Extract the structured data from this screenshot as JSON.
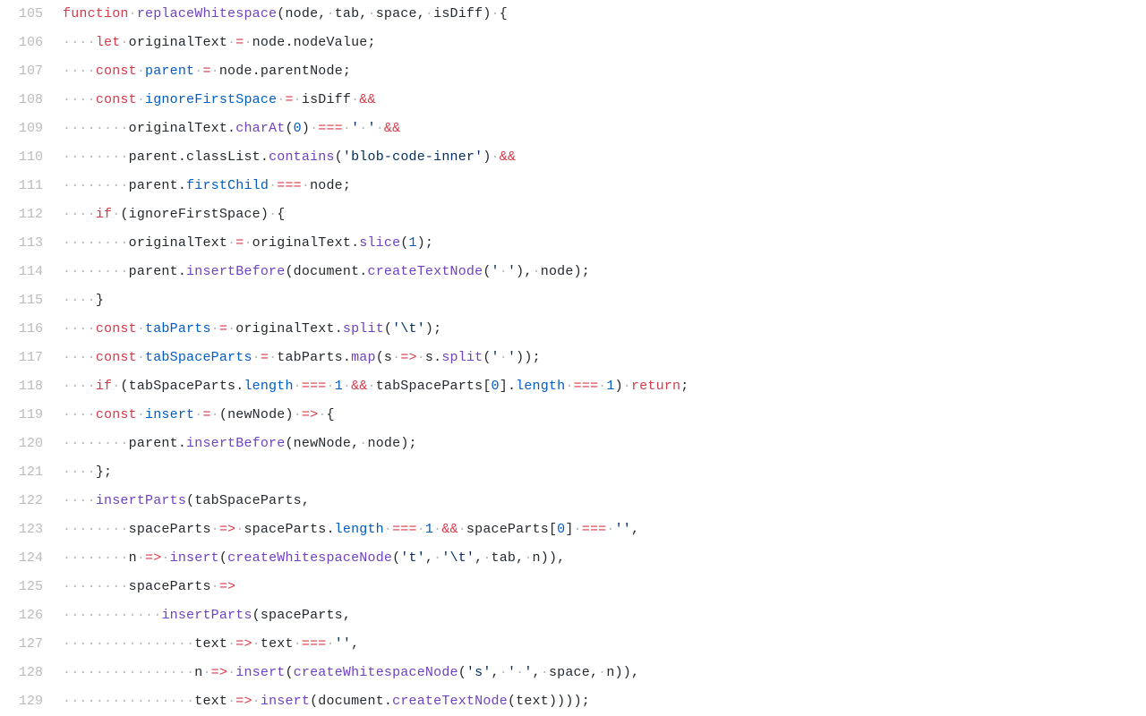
{
  "startLine": 105,
  "lines": [
    {
      "indent": 0,
      "tokens": [
        {
          "t": "kw",
          "v": "function"
        },
        {
          "t": "sp"
        },
        {
          "t": "fn",
          "v": "replaceWhitespace"
        },
        {
          "t": "pun",
          "v": "("
        },
        {
          "t": "var",
          "v": "node"
        },
        {
          "t": "pun",
          "v": ","
        },
        {
          "t": "sp"
        },
        {
          "t": "var",
          "v": "tab"
        },
        {
          "t": "pun",
          "v": ","
        },
        {
          "t": "sp"
        },
        {
          "t": "var",
          "v": "space"
        },
        {
          "t": "pun",
          "v": ","
        },
        {
          "t": "sp"
        },
        {
          "t": "var",
          "v": "isDiff"
        },
        {
          "t": "pun",
          "v": ")"
        },
        {
          "t": "sp"
        },
        {
          "t": "pun",
          "v": "{"
        }
      ]
    },
    {
      "indent": 4,
      "tokens": [
        {
          "t": "kw",
          "v": "let"
        },
        {
          "t": "sp"
        },
        {
          "t": "var",
          "v": "originalText"
        },
        {
          "t": "sp"
        },
        {
          "t": "op",
          "v": "="
        },
        {
          "t": "sp"
        },
        {
          "t": "var",
          "v": "node"
        },
        {
          "t": "pun",
          "v": "."
        },
        {
          "t": "var",
          "v": "nodeValue"
        },
        {
          "t": "pun",
          "v": ";"
        }
      ]
    },
    {
      "indent": 4,
      "tokens": [
        {
          "t": "kw",
          "v": "const"
        },
        {
          "t": "sp"
        },
        {
          "t": "decl",
          "v": "parent"
        },
        {
          "t": "sp"
        },
        {
          "t": "op",
          "v": "="
        },
        {
          "t": "sp"
        },
        {
          "t": "var",
          "v": "node"
        },
        {
          "t": "pun",
          "v": "."
        },
        {
          "t": "var",
          "v": "parentNode"
        },
        {
          "t": "pun",
          "v": ";"
        }
      ]
    },
    {
      "indent": 4,
      "tokens": [
        {
          "t": "kw",
          "v": "const"
        },
        {
          "t": "sp"
        },
        {
          "t": "decl",
          "v": "ignoreFirstSpace"
        },
        {
          "t": "sp"
        },
        {
          "t": "op",
          "v": "="
        },
        {
          "t": "sp"
        },
        {
          "t": "var",
          "v": "isDiff"
        },
        {
          "t": "sp"
        },
        {
          "t": "op",
          "v": "&&"
        }
      ]
    },
    {
      "indent": 8,
      "tokens": [
        {
          "t": "var",
          "v": "originalText"
        },
        {
          "t": "pun",
          "v": "."
        },
        {
          "t": "fn",
          "v": "charAt"
        },
        {
          "t": "pun",
          "v": "("
        },
        {
          "t": "num",
          "v": "0"
        },
        {
          "t": "pun",
          "v": ")"
        },
        {
          "t": "sp"
        },
        {
          "t": "op",
          "v": "==="
        },
        {
          "t": "sp"
        },
        {
          "t": "str",
          "v": "' '"
        },
        {
          "t": "sp"
        },
        {
          "t": "op",
          "v": "&&"
        }
      ]
    },
    {
      "indent": 8,
      "tokens": [
        {
          "t": "var",
          "v": "parent"
        },
        {
          "t": "pun",
          "v": "."
        },
        {
          "t": "var",
          "v": "classList"
        },
        {
          "t": "pun",
          "v": "."
        },
        {
          "t": "fn",
          "v": "contains"
        },
        {
          "t": "pun",
          "v": "("
        },
        {
          "t": "str",
          "v": "'blob-code-inner'"
        },
        {
          "t": "pun",
          "v": ")"
        },
        {
          "t": "sp"
        },
        {
          "t": "op",
          "v": "&&"
        }
      ]
    },
    {
      "indent": 8,
      "tokens": [
        {
          "t": "var",
          "v": "parent"
        },
        {
          "t": "pun",
          "v": "."
        },
        {
          "t": "decl",
          "v": "firstChild"
        },
        {
          "t": "sp"
        },
        {
          "t": "op",
          "v": "==="
        },
        {
          "t": "sp"
        },
        {
          "t": "var",
          "v": "node"
        },
        {
          "t": "pun",
          "v": ";"
        }
      ]
    },
    {
      "indent": 4,
      "tokens": [
        {
          "t": "kw",
          "v": "if"
        },
        {
          "t": "sp"
        },
        {
          "t": "pun",
          "v": "("
        },
        {
          "t": "var",
          "v": "ignoreFirstSpace"
        },
        {
          "t": "pun",
          "v": ")"
        },
        {
          "t": "sp"
        },
        {
          "t": "pun",
          "v": "{"
        }
      ]
    },
    {
      "indent": 8,
      "tokens": [
        {
          "t": "var",
          "v": "originalText"
        },
        {
          "t": "sp"
        },
        {
          "t": "op",
          "v": "="
        },
        {
          "t": "sp"
        },
        {
          "t": "var",
          "v": "originalText"
        },
        {
          "t": "pun",
          "v": "."
        },
        {
          "t": "fn",
          "v": "slice"
        },
        {
          "t": "pun",
          "v": "("
        },
        {
          "t": "num",
          "v": "1"
        },
        {
          "t": "pun",
          "v": ")"
        },
        {
          "t": "pun",
          "v": ";"
        }
      ]
    },
    {
      "indent": 8,
      "tokens": [
        {
          "t": "var",
          "v": "parent"
        },
        {
          "t": "pun",
          "v": "."
        },
        {
          "t": "fn",
          "v": "insertBefore"
        },
        {
          "t": "pun",
          "v": "("
        },
        {
          "t": "var",
          "v": "document"
        },
        {
          "t": "pun",
          "v": "."
        },
        {
          "t": "fn",
          "v": "createTextNode"
        },
        {
          "t": "pun",
          "v": "("
        },
        {
          "t": "str",
          "v": "' '"
        },
        {
          "t": "pun",
          "v": ")"
        },
        {
          "t": "pun",
          "v": ","
        },
        {
          "t": "sp"
        },
        {
          "t": "var",
          "v": "node"
        },
        {
          "t": "pun",
          "v": ")"
        },
        {
          "t": "pun",
          "v": ";"
        }
      ]
    },
    {
      "indent": 4,
      "tokens": [
        {
          "t": "pun",
          "v": "}"
        }
      ]
    },
    {
      "indent": 4,
      "tokens": [
        {
          "t": "kw",
          "v": "const"
        },
        {
          "t": "sp"
        },
        {
          "t": "decl",
          "v": "tabParts"
        },
        {
          "t": "sp"
        },
        {
          "t": "op",
          "v": "="
        },
        {
          "t": "sp"
        },
        {
          "t": "var",
          "v": "originalText"
        },
        {
          "t": "pun",
          "v": "."
        },
        {
          "t": "fn",
          "v": "split"
        },
        {
          "t": "pun",
          "v": "("
        },
        {
          "t": "str",
          "v": "'\\t'"
        },
        {
          "t": "pun",
          "v": ")"
        },
        {
          "t": "pun",
          "v": ";"
        }
      ]
    },
    {
      "indent": 4,
      "tokens": [
        {
          "t": "kw",
          "v": "const"
        },
        {
          "t": "sp"
        },
        {
          "t": "decl",
          "v": "tabSpaceParts"
        },
        {
          "t": "sp"
        },
        {
          "t": "op",
          "v": "="
        },
        {
          "t": "sp"
        },
        {
          "t": "var",
          "v": "tabParts"
        },
        {
          "t": "pun",
          "v": "."
        },
        {
          "t": "fn",
          "v": "map"
        },
        {
          "t": "pun",
          "v": "("
        },
        {
          "t": "var",
          "v": "s"
        },
        {
          "t": "sp"
        },
        {
          "t": "op",
          "v": "=>"
        },
        {
          "t": "sp"
        },
        {
          "t": "var",
          "v": "s"
        },
        {
          "t": "pun",
          "v": "."
        },
        {
          "t": "fn",
          "v": "split"
        },
        {
          "t": "pun",
          "v": "("
        },
        {
          "t": "str",
          "v": "' '"
        },
        {
          "t": "pun",
          "v": ")"
        },
        {
          "t": "pun",
          "v": ")"
        },
        {
          "t": "pun",
          "v": ";"
        }
      ]
    },
    {
      "indent": 4,
      "tokens": [
        {
          "t": "kw",
          "v": "if"
        },
        {
          "t": "sp"
        },
        {
          "t": "pun",
          "v": "("
        },
        {
          "t": "var",
          "v": "tabSpaceParts"
        },
        {
          "t": "pun",
          "v": "."
        },
        {
          "t": "decl",
          "v": "length"
        },
        {
          "t": "sp"
        },
        {
          "t": "op",
          "v": "==="
        },
        {
          "t": "sp"
        },
        {
          "t": "num",
          "v": "1"
        },
        {
          "t": "sp"
        },
        {
          "t": "op",
          "v": "&&"
        },
        {
          "t": "sp"
        },
        {
          "t": "var",
          "v": "tabSpaceParts"
        },
        {
          "t": "pun",
          "v": "["
        },
        {
          "t": "num",
          "v": "0"
        },
        {
          "t": "pun",
          "v": "]"
        },
        {
          "t": "pun",
          "v": "."
        },
        {
          "t": "decl",
          "v": "length"
        },
        {
          "t": "sp"
        },
        {
          "t": "op",
          "v": "==="
        },
        {
          "t": "sp"
        },
        {
          "t": "num",
          "v": "1"
        },
        {
          "t": "pun",
          "v": ")"
        },
        {
          "t": "sp"
        },
        {
          "t": "kw",
          "v": "return"
        },
        {
          "t": "pun",
          "v": ";"
        }
      ]
    },
    {
      "indent": 4,
      "tokens": [
        {
          "t": "kw",
          "v": "const"
        },
        {
          "t": "sp"
        },
        {
          "t": "decl",
          "v": "insert"
        },
        {
          "t": "sp"
        },
        {
          "t": "op",
          "v": "="
        },
        {
          "t": "sp"
        },
        {
          "t": "pun",
          "v": "("
        },
        {
          "t": "var",
          "v": "newNode"
        },
        {
          "t": "pun",
          "v": ")"
        },
        {
          "t": "sp"
        },
        {
          "t": "op",
          "v": "=>"
        },
        {
          "t": "sp"
        },
        {
          "t": "pun",
          "v": "{"
        }
      ]
    },
    {
      "indent": 8,
      "tokens": [
        {
          "t": "var",
          "v": "parent"
        },
        {
          "t": "pun",
          "v": "."
        },
        {
          "t": "fn",
          "v": "insertBefore"
        },
        {
          "t": "pun",
          "v": "("
        },
        {
          "t": "var",
          "v": "newNode"
        },
        {
          "t": "pun",
          "v": ","
        },
        {
          "t": "sp"
        },
        {
          "t": "var",
          "v": "node"
        },
        {
          "t": "pun",
          "v": ")"
        },
        {
          "t": "pun",
          "v": ";"
        }
      ]
    },
    {
      "indent": 4,
      "tokens": [
        {
          "t": "pun",
          "v": "}"
        },
        {
          "t": "pun",
          "v": ";"
        }
      ]
    },
    {
      "indent": 4,
      "tokens": [
        {
          "t": "fn",
          "v": "insertParts"
        },
        {
          "t": "pun",
          "v": "("
        },
        {
          "t": "var",
          "v": "tabSpaceParts"
        },
        {
          "t": "pun",
          "v": ","
        }
      ]
    },
    {
      "indent": 8,
      "tokens": [
        {
          "t": "var",
          "v": "spaceParts"
        },
        {
          "t": "sp"
        },
        {
          "t": "op",
          "v": "=>"
        },
        {
          "t": "sp"
        },
        {
          "t": "var",
          "v": "spaceParts"
        },
        {
          "t": "pun",
          "v": "."
        },
        {
          "t": "decl",
          "v": "length"
        },
        {
          "t": "sp"
        },
        {
          "t": "op",
          "v": "==="
        },
        {
          "t": "sp"
        },
        {
          "t": "num",
          "v": "1"
        },
        {
          "t": "sp"
        },
        {
          "t": "op",
          "v": "&&"
        },
        {
          "t": "sp"
        },
        {
          "t": "var",
          "v": "spaceParts"
        },
        {
          "t": "pun",
          "v": "["
        },
        {
          "t": "num",
          "v": "0"
        },
        {
          "t": "pun",
          "v": "]"
        },
        {
          "t": "sp"
        },
        {
          "t": "op",
          "v": "==="
        },
        {
          "t": "sp"
        },
        {
          "t": "str",
          "v": "''"
        },
        {
          "t": "pun",
          "v": ","
        }
      ]
    },
    {
      "indent": 8,
      "tokens": [
        {
          "t": "var",
          "v": "n"
        },
        {
          "t": "sp"
        },
        {
          "t": "op",
          "v": "=>"
        },
        {
          "t": "sp"
        },
        {
          "t": "fn",
          "v": "insert"
        },
        {
          "t": "pun",
          "v": "("
        },
        {
          "t": "fn",
          "v": "createWhitespaceNode"
        },
        {
          "t": "pun",
          "v": "("
        },
        {
          "t": "str",
          "v": "'t'"
        },
        {
          "t": "pun",
          "v": ","
        },
        {
          "t": "sp"
        },
        {
          "t": "str",
          "v": "'\\t'"
        },
        {
          "t": "pun",
          "v": ","
        },
        {
          "t": "sp"
        },
        {
          "t": "var",
          "v": "tab"
        },
        {
          "t": "pun",
          "v": ","
        },
        {
          "t": "sp"
        },
        {
          "t": "var",
          "v": "n"
        },
        {
          "t": "pun",
          "v": ")"
        },
        {
          "t": "pun",
          "v": ")"
        },
        {
          "t": "pun",
          "v": ","
        }
      ]
    },
    {
      "indent": 8,
      "tokens": [
        {
          "t": "var",
          "v": "spaceParts"
        },
        {
          "t": "sp"
        },
        {
          "t": "op",
          "v": "=>"
        }
      ]
    },
    {
      "indent": 12,
      "tokens": [
        {
          "t": "fn",
          "v": "insertParts"
        },
        {
          "t": "pun",
          "v": "("
        },
        {
          "t": "var",
          "v": "spaceParts"
        },
        {
          "t": "pun",
          "v": ","
        }
      ]
    },
    {
      "indent": 16,
      "tokens": [
        {
          "t": "var",
          "v": "text"
        },
        {
          "t": "sp"
        },
        {
          "t": "op",
          "v": "=>"
        },
        {
          "t": "sp"
        },
        {
          "t": "var",
          "v": "text"
        },
        {
          "t": "sp"
        },
        {
          "t": "op",
          "v": "==="
        },
        {
          "t": "sp"
        },
        {
          "t": "str",
          "v": "''"
        },
        {
          "t": "pun",
          "v": ","
        }
      ]
    },
    {
      "indent": 16,
      "tokens": [
        {
          "t": "var",
          "v": "n"
        },
        {
          "t": "sp"
        },
        {
          "t": "op",
          "v": "=>"
        },
        {
          "t": "sp"
        },
        {
          "t": "fn",
          "v": "insert"
        },
        {
          "t": "pun",
          "v": "("
        },
        {
          "t": "fn",
          "v": "createWhitespaceNode"
        },
        {
          "t": "pun",
          "v": "("
        },
        {
          "t": "str",
          "v": "'s'"
        },
        {
          "t": "pun",
          "v": ","
        },
        {
          "t": "sp"
        },
        {
          "t": "str",
          "v": "' '"
        },
        {
          "t": "pun",
          "v": ","
        },
        {
          "t": "sp"
        },
        {
          "t": "var",
          "v": "space"
        },
        {
          "t": "pun",
          "v": ","
        },
        {
          "t": "sp"
        },
        {
          "t": "var",
          "v": "n"
        },
        {
          "t": "pun",
          "v": ")"
        },
        {
          "t": "pun",
          "v": ")"
        },
        {
          "t": "pun",
          "v": ","
        }
      ]
    },
    {
      "indent": 16,
      "tokens": [
        {
          "t": "var",
          "v": "text"
        },
        {
          "t": "sp"
        },
        {
          "t": "op",
          "v": "=>"
        },
        {
          "t": "sp"
        },
        {
          "t": "fn",
          "v": "insert"
        },
        {
          "t": "pun",
          "v": "("
        },
        {
          "t": "var",
          "v": "document"
        },
        {
          "t": "pun",
          "v": "."
        },
        {
          "t": "fn",
          "v": "createTextNode"
        },
        {
          "t": "pun",
          "v": "("
        },
        {
          "t": "var",
          "v": "text"
        },
        {
          "t": "pun",
          "v": ")"
        },
        {
          "t": "pun",
          "v": ")"
        },
        {
          "t": "pun",
          "v": ")"
        },
        {
          "t": "pun",
          "v": ")"
        },
        {
          "t": "pun",
          "v": ";"
        }
      ]
    }
  ]
}
